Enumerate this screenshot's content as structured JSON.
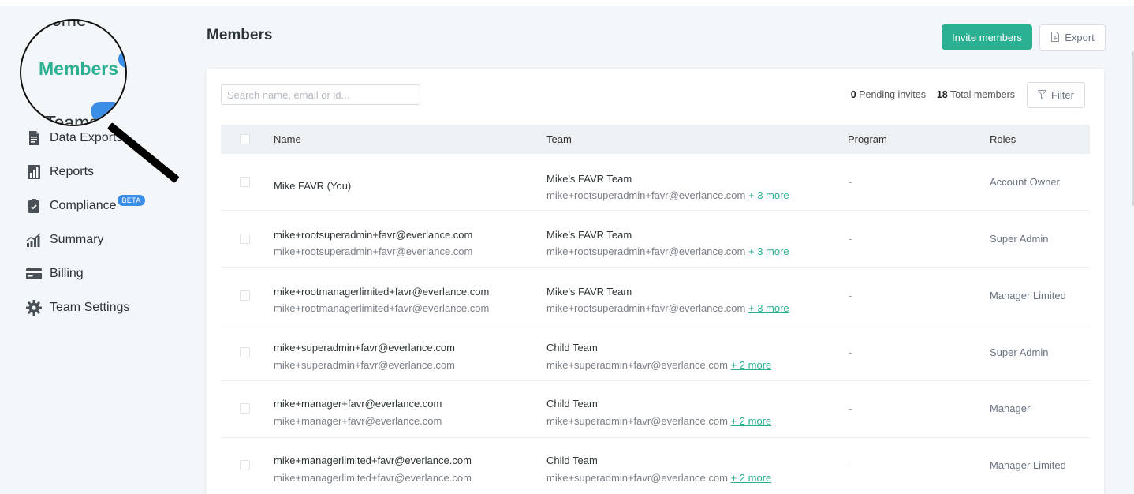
{
  "sidebar": {
    "items": [
      {
        "label": "Data Exports",
        "icon": "data-exports-icon"
      },
      {
        "label": "Reports",
        "icon": "reports-icon"
      },
      {
        "label": "Compliance",
        "icon": "compliance-icon",
        "badge": "BETA"
      },
      {
        "label": "Summary",
        "icon": "summary-icon"
      },
      {
        "label": "Billing",
        "icon": "billing-icon"
      },
      {
        "label": "Team Settings",
        "icon": "gear-icon"
      }
    ]
  },
  "magnifier": {
    "label": "Members",
    "top_fragment": "ome",
    "bottom_fragment": "Teams",
    "accent": "#2bb092"
  },
  "header": {
    "title": "Members",
    "invite_label": "Invite members",
    "export_label": "Export"
  },
  "toolbar": {
    "search_placeholder": "Search name, email or id...",
    "pending_count": "0",
    "pending_label": "Pending invites",
    "total_count": "18",
    "total_label": "Total members",
    "filter_label": "Filter"
  },
  "table": {
    "columns": [
      "Name",
      "Team",
      "Program",
      "Roles"
    ],
    "rows": [
      {
        "name": "Mike FAVR (You)",
        "email": "",
        "team": "Mike's FAVR Team",
        "team_email": "mike+rootsuperadmin+favr@everlance.com",
        "more": "+ 3 more",
        "program": "-",
        "role": "Account Owner"
      },
      {
        "name": "mike+rootsuperadmin+favr@everlance.com",
        "email": "mike+rootsuperadmin+favr@everlance.com",
        "team": "Mike's FAVR Team",
        "team_email": "mike+rootsuperadmin+favr@everlance.com",
        "more": "+ 3 more",
        "program": "-",
        "role": "Super Admin"
      },
      {
        "name": "mike+rootmanagerlimited+favr@everlance.com",
        "email": "mike+rootmanagerlimited+favr@everlance.com",
        "team": "Mike's FAVR Team",
        "team_email": "mike+rootsuperadmin+favr@everlance.com",
        "more": "+ 3 more",
        "program": "-",
        "role": "Manager Limited"
      },
      {
        "name": "mike+superadmin+favr@everlance.com",
        "email": "mike+superadmin+favr@everlance.com",
        "team": "Child Team",
        "team_email": "mike+superadmin+favr@everlance.com",
        "more": "+ 2 more",
        "program": "-",
        "role": "Super Admin"
      },
      {
        "name": "mike+manager+favr@everlance.com",
        "email": "mike+manager+favr@everlance.com",
        "team": "Child Team",
        "team_email": "mike+superadmin+favr@everlance.com",
        "more": "+ 2 more",
        "program": "-",
        "role": "Manager"
      },
      {
        "name": "mike+managerlimited+favr@everlance.com",
        "email": "mike+managerlimited+favr@everlance.com",
        "team": "Child Team",
        "team_email": "mike+superadmin+favr@everlance.com",
        "more": "+ 2 more",
        "program": "-",
        "role": "Manager Limited"
      }
    ]
  },
  "colors": {
    "accent": "#2bb092",
    "badge": "#3a8ee6"
  }
}
